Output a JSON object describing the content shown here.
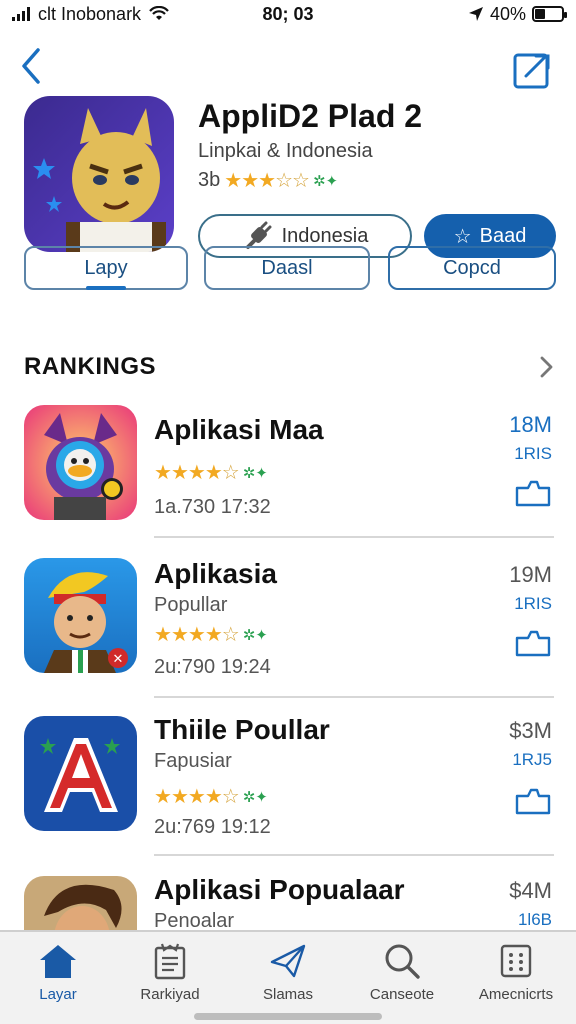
{
  "status": {
    "carrier": "clt Inobonark",
    "time": "80; 03",
    "battery": "40%",
    "battery_level": 0.4
  },
  "app": {
    "title": "AppliD2 Plad 2",
    "subtitle": "Linpkai & Indonesia",
    "rating_prefix": "3b",
    "stars_filled": 3,
    "stars_total": 5,
    "region_label": "Indonesia",
    "action_label": "Baad"
  },
  "segments": [
    "Lapy",
    "Daasl",
    "Copcd"
  ],
  "section": {
    "title": "RANKINGS"
  },
  "rankings": [
    {
      "title": "Aplikasi Maa",
      "subtitle": "",
      "date": "1a.730 17:32",
      "size": "18M",
      "tag": "1RIS",
      "stars_filled": 4,
      "size_color": "#1a6fc0"
    },
    {
      "title": "Aplikasia",
      "subtitle": "Popullar",
      "date": "2u:790 19:24",
      "size": "19M",
      "tag": "1RIS",
      "stars_filled": 4,
      "size_color": "#555555"
    },
    {
      "title": "Thiile Poullar",
      "subtitle": "Fapusiar",
      "date": "2u:769 19:12",
      "size": "$3M",
      "tag": "1RJ5",
      "stars_filled": 4,
      "size_color": "#555555"
    },
    {
      "title": "Aplikasi Popualaar",
      "subtitle": "Penoalar",
      "date": "",
      "size": "$4M",
      "tag": "1l6B",
      "stars_filled": 0,
      "size_color": "#555555"
    }
  ],
  "tabs": [
    {
      "label": "Layar",
      "icon": "home-icon",
      "active": true
    },
    {
      "label": "Rarkiyad",
      "icon": "clipboard-icon",
      "active": false
    },
    {
      "label": "Slamas",
      "icon": "send-icon",
      "active": false
    },
    {
      "label": "Canseote",
      "icon": "search-icon",
      "active": false
    },
    {
      "label": "Amecnicrts",
      "icon": "grid-icon",
      "active": false
    }
  ],
  "colors": {
    "accent": "#1560ad",
    "star": "#f2a922",
    "tab_active": "#1a5aa6"
  }
}
